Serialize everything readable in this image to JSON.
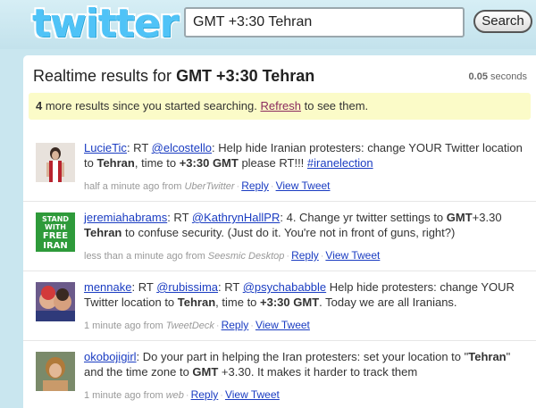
{
  "header": {
    "logo": "twitter",
    "search_value": "GMT +3:30 Tehran",
    "search_button": "Search"
  },
  "results": {
    "prefix": "Realtime results for ",
    "query": "GMT +3:30 Tehran",
    "timing_value": "0.05",
    "timing_unit": " seconds"
  },
  "notice": {
    "count": "4",
    "text_before": " more results since you started searching. ",
    "refresh": "Refresh",
    "text_after": " to see them."
  },
  "tweets": [
    {
      "user": "LucieTic",
      "segments": [
        {
          "t": ": RT "
        },
        {
          "a": "@elcostello"
        },
        {
          "t": ": Help hide Iranian protesters: change YOUR Twitter location to "
        },
        {
          "b": "Tehran"
        },
        {
          "t": ", time to "
        },
        {
          "b": "+3:30 GMT"
        },
        {
          "t": " please RT!!! "
        },
        {
          "a": "#iranelection"
        }
      ],
      "time": "half a minute ago from ",
      "source": "UberTwitter",
      "reply": "Reply",
      "view": "View Tweet"
    },
    {
      "user": "jeremiahabrams",
      "segments": [
        {
          "t": ": RT "
        },
        {
          "a": "@KathrynHallPR"
        },
        {
          "t": ": 4. Change yr twitter settings to "
        },
        {
          "b": "GMT"
        },
        {
          "t": "+3.30 "
        },
        {
          "b": "Tehran"
        },
        {
          "t": " to confuse security. (Just do it. You're not in front of guns, right?)"
        }
      ],
      "time": "less than a minute ago from ",
      "source": "Seesmic Desktop",
      "reply": "Reply",
      "view": "View Tweet",
      "badge": [
        "STAND",
        "WITH",
        "FREE",
        "IRAN"
      ]
    },
    {
      "user": "mennake",
      "segments": [
        {
          "t": ": RT "
        },
        {
          "a": "@rubissima"
        },
        {
          "t": ": RT "
        },
        {
          "a": "@psychababble"
        },
        {
          "t": " Help hide protesters: change YOUR Twitter location to "
        },
        {
          "b": "Tehran"
        },
        {
          "t": ", time to "
        },
        {
          "b": "+3:30 GMT"
        },
        {
          "t": ". Today we are all Iranians."
        }
      ],
      "time": "1 minute ago from ",
      "source": "TweetDeck",
      "reply": "Reply",
      "view": "View Tweet"
    },
    {
      "user": "okobojigirl",
      "segments": [
        {
          "t": ": Do your part in helping the Iran protesters: set your location to \""
        },
        {
          "b": "Tehran"
        },
        {
          "t": "\" and the time zone to "
        },
        {
          "b": "GMT"
        },
        {
          "t": " +3.30. It makes it harder to track them"
        }
      ],
      "time": "1 minute ago from ",
      "source": "web",
      "reply": "Reply",
      "view": "View Tweet"
    }
  ],
  "colors": {
    "link": "#1a3cc2",
    "notice_bg": "#fbfbc8",
    "refresh": "#8b2a5e",
    "logo": "#4fc3f7",
    "badge_green": "#2e9a3a"
  }
}
